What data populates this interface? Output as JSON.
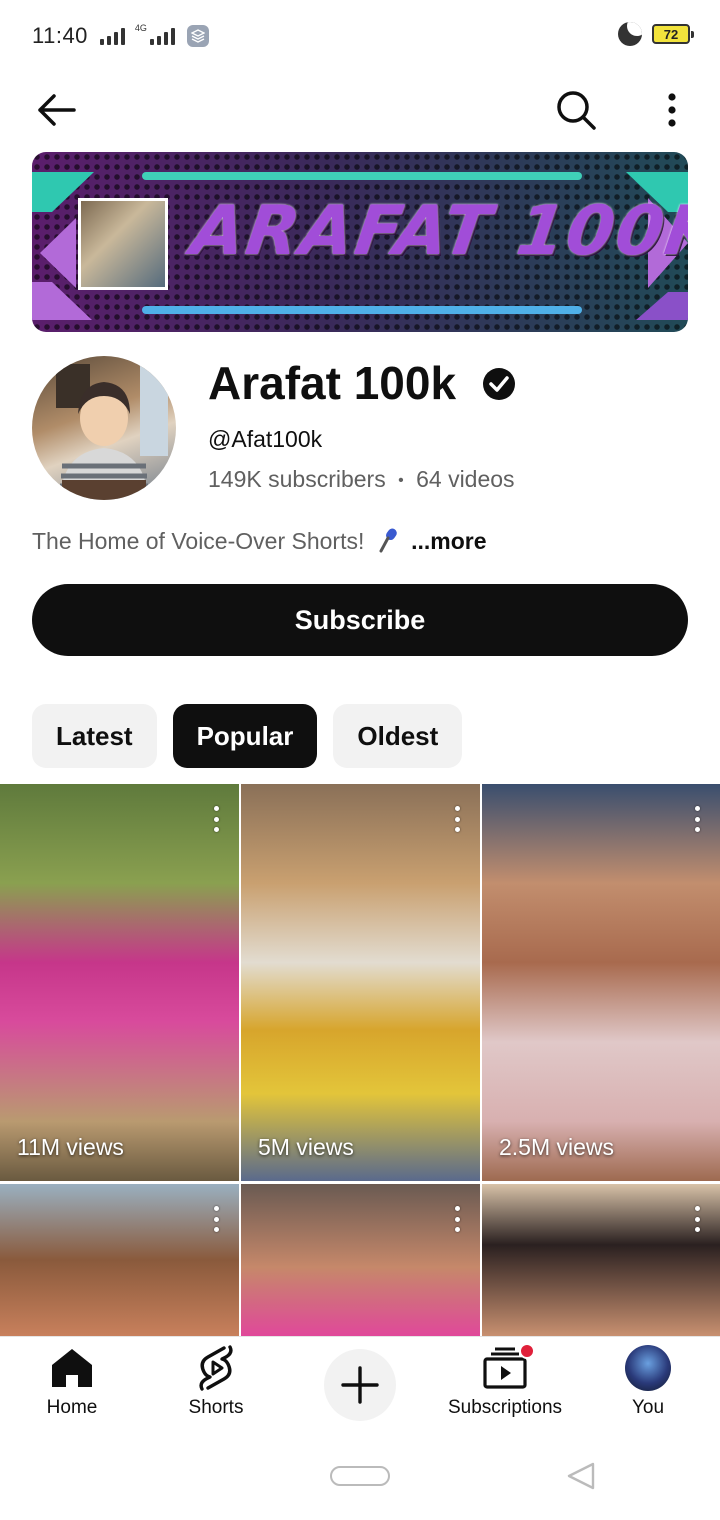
{
  "status_bar": {
    "time": "11:40",
    "network_label": "4G",
    "battery": "72"
  },
  "top_bar": {
    "back_icon": "arrow-left-icon",
    "search_icon": "search-icon",
    "more_icon": "more-vertical-icon"
  },
  "banner": {
    "text": "ARAFAT 100K"
  },
  "channel": {
    "name": "Arafat 100k",
    "handle": "@Afat100k",
    "subscribers": "149K subscribers",
    "separator": "•",
    "videos": "64 videos",
    "description": "The Home of Voice-Over Shorts!",
    "more_label": "...more",
    "subscribe_label": "Subscribe"
  },
  "chips": [
    {
      "label": "Latest",
      "active": false
    },
    {
      "label": "Popular",
      "active": true
    },
    {
      "label": "Oldest",
      "active": false
    }
  ],
  "shorts": [
    {
      "views": "11M views"
    },
    {
      "views": "5M views"
    },
    {
      "views": "2.5M views"
    },
    {
      "views": ""
    },
    {
      "views": ""
    },
    {
      "views": ""
    }
  ],
  "bottom_nav": {
    "home": "Home",
    "shorts": "Shorts",
    "subscriptions": "Subscriptions",
    "you": "You"
  },
  "colors": {
    "accent_dark": "#0f0f0f",
    "secondary_text": "#606060",
    "chip_bg": "#f2f2f2",
    "notification": "#e0203a"
  }
}
